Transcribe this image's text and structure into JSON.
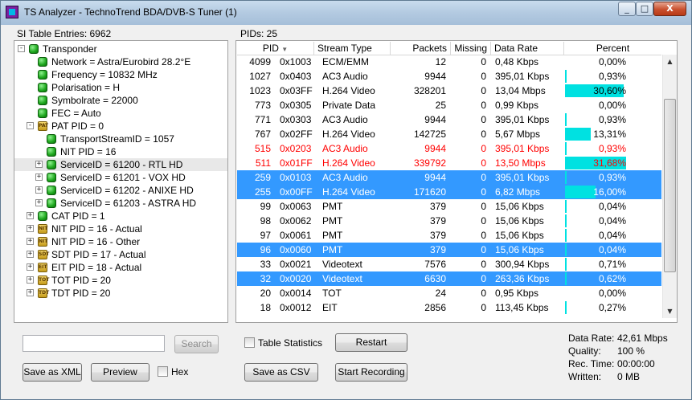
{
  "window": {
    "title": "TS Analyzer - TechnoTrend BDA/DVB-S Tuner (1)",
    "controls": {
      "minimize": "_",
      "restore": "□",
      "close": "X"
    }
  },
  "left": {
    "header": "SI Table Entries: 6962",
    "tree": [
      {
        "label": "Transponder",
        "icon": "green-node-icon",
        "exp": "-"
      },
      {
        "label": "Network = Astra/Eurobird 28.2°E",
        "icon": "green-node-icon",
        "exp": ""
      },
      {
        "label": "Frequency = 10832 MHz",
        "icon": "green-node-icon",
        "exp": ""
      },
      {
        "label": "Polarisation = H",
        "icon": "green-node-icon",
        "exp": ""
      },
      {
        "label": "Symbolrate = 22000",
        "icon": "green-node-icon",
        "exp": ""
      },
      {
        "label": "FEC = Auto",
        "icon": "green-node-icon",
        "exp": ""
      },
      {
        "label": "PAT PID = 0",
        "icon": "pat-table-icon",
        "exp": "-",
        "tag": "PAT"
      },
      {
        "label": "TransportStreamID = 1057",
        "icon": "green-node-icon",
        "exp": ""
      },
      {
        "label": "NIT PID = 16",
        "icon": "green-node-icon",
        "exp": ""
      },
      {
        "label": "ServiceID = 61200 - RTL HD",
        "icon": "green-node-icon",
        "exp": "+"
      },
      {
        "label": "ServiceID = 61201 - VOX HD",
        "icon": "green-node-icon",
        "exp": "+"
      },
      {
        "label": "ServiceID = 61202 - ANIXE HD",
        "icon": "green-node-icon",
        "exp": "+"
      },
      {
        "label": "ServiceID = 61203 - ASTRA HD",
        "icon": "green-node-icon",
        "exp": "+"
      },
      {
        "label": "CAT PID = 1",
        "icon": "green-node-icon",
        "exp": "+"
      },
      {
        "label": "NIT PID = 16 - Actual",
        "icon": "nit-table-icon",
        "exp": "+",
        "tag": "NIT"
      },
      {
        "label": "NIT PID = 16 - Other",
        "icon": "nit-table-icon",
        "exp": "+",
        "tag": "NIT"
      },
      {
        "label": "SDT PID = 17 - Actual",
        "icon": "sdt-table-icon",
        "exp": "+",
        "tag": "SDT"
      },
      {
        "label": "EIT PID = 18 - Actual",
        "icon": "eit-table-icon",
        "exp": "+",
        "tag": "EIT"
      },
      {
        "label": "TOT PID = 20",
        "icon": "tot-table-icon",
        "exp": "+",
        "tag": "TOT"
      },
      {
        "label": "TDT PID = 20",
        "icon": "tdt-table-icon",
        "exp": "+",
        "tag": "TDT"
      }
    ],
    "search_button": "Search",
    "save_xml_button": "Save as XML",
    "preview_button": "Preview",
    "hex_label": "Hex"
  },
  "right": {
    "header": "PIDs: 25",
    "columns": [
      "PID",
      "",
      "Stream Type",
      "Packets",
      "Missing",
      "Data Rate",
      "Percent"
    ],
    "rows": [
      {
        "pid": "4099",
        "hex": "0x1003",
        "type": "ECM/EMM",
        "packets": "12",
        "missing": "0",
        "rate": "0,48 Kbps",
        "pct": "0,00%",
        "p": 0.0,
        "state": ""
      },
      {
        "pid": "1027",
        "hex": "0x0403",
        "type": "AC3 Audio",
        "packets": "9944",
        "missing": "0",
        "rate": "395,01 Kbps",
        "pct": "0,93%",
        "p": 0.93,
        "state": ""
      },
      {
        "pid": "1023",
        "hex": "0x03FF",
        "type": "H.264 Video",
        "packets": "328201",
        "missing": "0",
        "rate": "13,04 Mbps",
        "pct": "30,60%",
        "p": 30.6,
        "state": ""
      },
      {
        "pid": "773",
        "hex": "0x0305",
        "type": "Private Data",
        "packets": "25",
        "missing": "0",
        "rate": "0,99 Kbps",
        "pct": "0,00%",
        "p": 0.0,
        "state": ""
      },
      {
        "pid": "771",
        "hex": "0x0303",
        "type": "AC3 Audio",
        "packets": "9944",
        "missing": "0",
        "rate": "395,01 Kbps",
        "pct": "0,93%",
        "p": 0.93,
        "state": ""
      },
      {
        "pid": "767",
        "hex": "0x02FF",
        "type": "H.264 Video",
        "packets": "142725",
        "missing": "0",
        "rate": "5,67 Mbps",
        "pct": "13,31%",
        "p": 13.31,
        "state": ""
      },
      {
        "pid": "515",
        "hex": "0x0203",
        "type": "AC3 Audio",
        "packets": "9944",
        "missing": "0",
        "rate": "395,01 Kbps",
        "pct": "0,93%",
        "p": 0.93,
        "state": "red"
      },
      {
        "pid": "511",
        "hex": "0x01FF",
        "type": "H.264 Video",
        "packets": "339792",
        "missing": "0",
        "rate": "13,50 Mbps",
        "pct": "31,68%",
        "p": 31.68,
        "state": "red"
      },
      {
        "pid": "259",
        "hex": "0x0103",
        "type": "AC3 Audio",
        "packets": "9944",
        "missing": "0",
        "rate": "395,01 Kbps",
        "pct": "0,93%",
        "p": 0.93,
        "state": "selected"
      },
      {
        "pid": "255",
        "hex": "0x00FF",
        "type": "H.264 Video",
        "packets": "171620",
        "missing": "0",
        "rate": "6,82 Mbps",
        "pct": "16,00%",
        "p": 16.0,
        "state": "selected"
      },
      {
        "pid": "99",
        "hex": "0x0063",
        "type": "PMT",
        "packets": "379",
        "missing": "0",
        "rate": "15,06 Kbps",
        "pct": "0,04%",
        "p": 0.04,
        "state": ""
      },
      {
        "pid": "98",
        "hex": "0x0062",
        "type": "PMT",
        "packets": "379",
        "missing": "0",
        "rate": "15,06 Kbps",
        "pct": "0,04%",
        "p": 0.04,
        "state": ""
      },
      {
        "pid": "97",
        "hex": "0x0061",
        "type": "PMT",
        "packets": "379",
        "missing": "0",
        "rate": "15,06 Kbps",
        "pct": "0,04%",
        "p": 0.04,
        "state": ""
      },
      {
        "pid": "96",
        "hex": "0x0060",
        "type": "PMT",
        "packets": "379",
        "missing": "0",
        "rate": "15,06 Kbps",
        "pct": "0,04%",
        "p": 0.04,
        "state": "selected"
      },
      {
        "pid": "33",
        "hex": "0x0021",
        "type": "Videotext",
        "packets": "7576",
        "missing": "0",
        "rate": "300,94 Kbps",
        "pct": "0,71%",
        "p": 0.71,
        "state": ""
      },
      {
        "pid": "32",
        "hex": "0x0020",
        "type": "Videotext",
        "packets": "6630",
        "missing": "0",
        "rate": "263,36 Kbps",
        "pct": "0,62%",
        "p": 0.62,
        "state": "selected"
      },
      {
        "pid": "20",
        "hex": "0x0014",
        "type": "TOT",
        "packets": "24",
        "missing": "0",
        "rate": "0,95 Kbps",
        "pct": "0,00%",
        "p": 0.0,
        "state": ""
      },
      {
        "pid": "18",
        "hex": "0x0012",
        "type": "EIT",
        "packets": "2856",
        "missing": "0",
        "rate": "113,45 Kbps",
        "pct": "0,27%",
        "p": 0.27,
        "state": ""
      }
    ],
    "table_statistics_label": "Table Statistics",
    "restart_button": "Restart",
    "save_csv_button": "Save as CSV",
    "start_recording_button": "Start Recording"
  },
  "status": {
    "data_rate_label": "Data Rate:",
    "data_rate": "42,61 Mbps",
    "quality_label": "Quality:",
    "quality": "100 %",
    "rec_time_label": "Rec. Time:",
    "rec_time": "00:00:00",
    "written_label": "Written:",
    "written": "0 MB"
  }
}
